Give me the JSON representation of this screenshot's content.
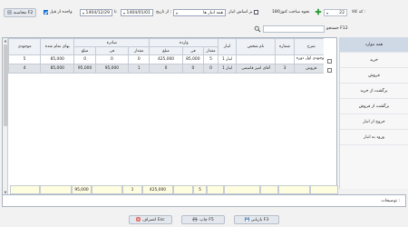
{
  "toolbar": {
    "save_f2_label": "محاسبه F2",
    "unit_checkbox_label": "واحده از قبل",
    "date_to_value": "1404/12/29",
    "to_label": "تا",
    "date_from_value": "1404/01/01",
    "from_date_label": "از تاریخ :",
    "warehouse_combo_value": "همه انبار ها",
    "by_warehouse_label": "بر اساس انبار",
    "settings_label": "نحوه ساخت کنوز180",
    "code_value": "22",
    "code_label": "کد کالا :"
  },
  "search": {
    "label": "جستجو F12",
    "value": ""
  },
  "sidebar": {
    "items": [
      {
        "label": "همه موارد",
        "active": true
      },
      {
        "label": "خرید"
      },
      {
        "label": "فروش"
      },
      {
        "label": "برگشت از خرید"
      },
      {
        "label": "برگشت از فروش"
      },
      {
        "label": "خروج از انبار"
      },
      {
        "label": "ورود به انبار"
      }
    ]
  },
  "table": {
    "group_headers": {
      "incoming": "وارده",
      "outgoing": "صادره"
    },
    "headers": {
      "date": "تاریخ",
      "desc": "شرح",
      "number": "شماره",
      "person": "نام شخص",
      "warehouse": "انبار",
      "qty": "مقدار",
      "unit_price": "فی",
      "amount": "مبلغ",
      "remaining_value": "بهای تمام شده",
      "stock": "موجودی"
    },
    "rows": [
      {
        "date": "1404/01/01",
        "desc": "موجودی اول دوره",
        "number": "",
        "person": "",
        "warehouse": "انبار 1",
        "in_qty": "5",
        "in_price": "85,000",
        "in_amount": "425,000",
        "out_qty": "0",
        "out_price": "0",
        "out_amount": "0",
        "remaining": "85,000",
        "stock": "5",
        "selected": false
      },
      {
        "date": "1404/04/17",
        "desc": "فروش",
        "number": "3",
        "person": "آقای امیر قاسمی",
        "warehouse": "انبار 1",
        "in_qty": "0",
        "in_price": "0",
        "in_amount": "0",
        "out_qty": "1",
        "out_price": "95,000",
        "out_amount": "95,000",
        "remaining": "85,000",
        "stock": "4",
        "selected": true
      }
    ],
    "totals": {
      "in_qty": "5",
      "in_amount": "425,000",
      "out_qty": "1",
      "out_amount": "95,000"
    }
  },
  "notes": {
    "label": "توضیحات :"
  },
  "buttons": {
    "refresh": "بازیابی F3",
    "print": "چاپ F5",
    "cancel": "انصراف Esc"
  },
  "colors": {
    "accent": "#1e88e5",
    "selected_row": "#dfe3e8",
    "totals_bg": "#fffde0",
    "green_plus": "#2e9e3e"
  }
}
